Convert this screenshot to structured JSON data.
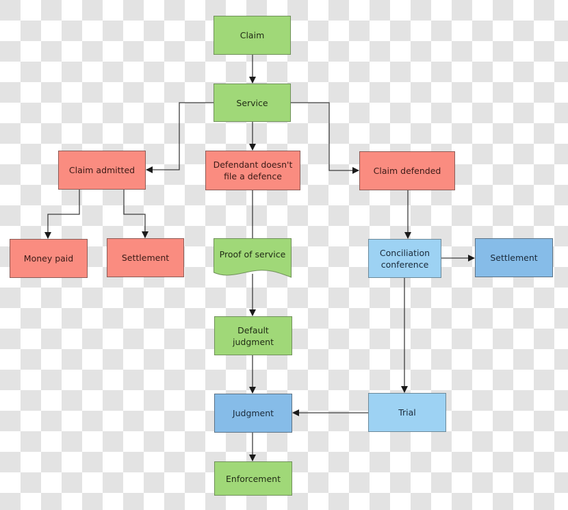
{
  "diagram": {
    "colors": {
      "green": "#a0d878",
      "salmon": "#fa8c80",
      "blue": "#86bce8",
      "light_blue": "#9dd2f3",
      "connector": "#3c3c3c"
    },
    "nodes": {
      "claim": {
        "label": "Claim"
      },
      "service": {
        "label": "Service"
      },
      "claim_admitted": {
        "label": "Claim admitted"
      },
      "defendant_no_defence": {
        "label": "Defendant doesn't file a defence"
      },
      "claim_defended": {
        "label": "Claim defended"
      },
      "money_paid": {
        "label": "Money paid"
      },
      "settlement_left": {
        "label": "Settlement"
      },
      "proof_of_service": {
        "label": "Proof of service"
      },
      "conciliation_conference": {
        "label": "Conciliation conference"
      },
      "settlement_right": {
        "label": "Settlement"
      },
      "default_judgment": {
        "label": "Default judgment"
      },
      "judgment": {
        "label": "Judgment"
      },
      "trial": {
        "label": "Trial"
      },
      "enforcement": {
        "label": "Enforcement"
      }
    },
    "edges": [
      {
        "from": "claim",
        "to": "service",
        "arrow": true
      },
      {
        "from": "service",
        "to": "claim_admitted",
        "arrow": true
      },
      {
        "from": "service",
        "to": "defendant_no_defence",
        "arrow": true
      },
      {
        "from": "service",
        "to": "claim_defended",
        "arrow": true
      },
      {
        "from": "claim_admitted",
        "to": "money_paid",
        "arrow": true
      },
      {
        "from": "claim_admitted",
        "to": "settlement_left",
        "arrow": true
      },
      {
        "from": "defendant_no_defence",
        "to": "proof_of_service",
        "arrow": false
      },
      {
        "from": "proof_of_service",
        "to": "default_judgment",
        "arrow": true
      },
      {
        "from": "default_judgment",
        "to": "judgment",
        "arrow": true
      },
      {
        "from": "claim_defended",
        "to": "conciliation_conference",
        "arrow": true
      },
      {
        "from": "conciliation_conference",
        "to": "settlement_right",
        "arrow": true
      },
      {
        "from": "conciliation_conference",
        "to": "trial",
        "arrow": true
      },
      {
        "from": "trial",
        "to": "judgment",
        "arrow": true
      },
      {
        "from": "judgment",
        "to": "enforcement",
        "arrow": true
      }
    ]
  }
}
